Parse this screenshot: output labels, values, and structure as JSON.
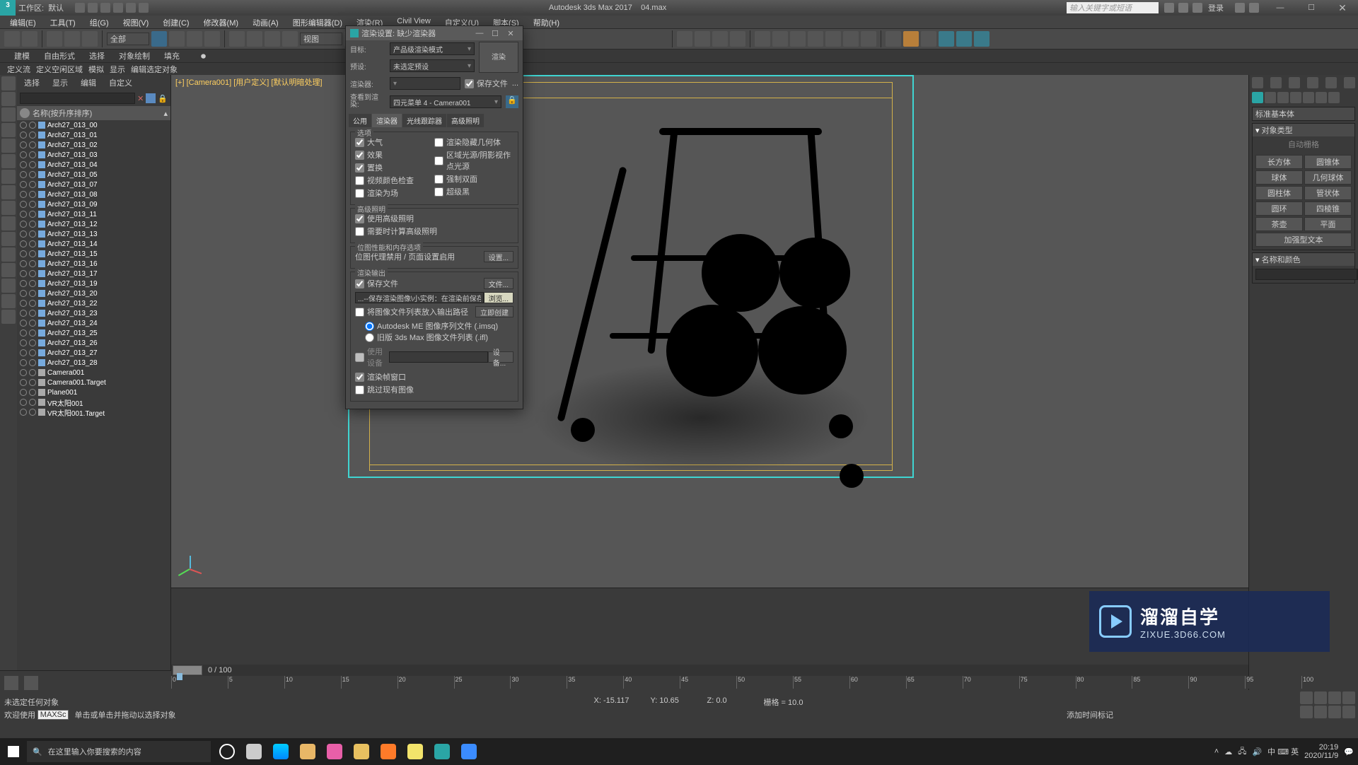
{
  "title_app": "Autodesk 3ds Max 2017",
  "title_file": "04.max",
  "workspace_label": "工作区:",
  "workspace_name": "默认",
  "search_placeholder": "输入关键字或短语",
  "signin": "登录",
  "menus": [
    "编辑(E)",
    "工具(T)",
    "组(G)",
    "视图(V)",
    "创建(C)",
    "修改器(M)",
    "动画(A)",
    "图形编辑器(D)",
    "渲染(R)",
    "Civil View",
    "自定义(U)",
    "脚本(S)",
    "帮助(H)"
  ],
  "ribbon_dropdown": "全部",
  "ribbon_view": "视图",
  "subbar1": [
    "建模",
    "自由形式",
    "选择",
    "对象绘制",
    "填充"
  ],
  "subbar2": [
    "定义流",
    "定义空闲区域",
    "模拟",
    "显示",
    "编辑选定对象"
  ],
  "scene_modes": [
    "选择",
    "显示",
    "编辑",
    "自定义"
  ],
  "scene_header": "名称(按升序排序)",
  "scene_items": [
    "Arch27_013_00",
    "Arch27_013_01",
    "Arch27_013_02",
    "Arch27_013_03",
    "Arch27_013_04",
    "Arch27_013_05",
    "Arch27_013_07",
    "Arch27_013_08",
    "Arch27_013_09",
    "Arch27_013_11",
    "Arch27_013_12",
    "Arch27_013_13",
    "Arch27_013_14",
    "Arch27_013_15",
    "Arch27_013_16",
    "Arch27_013_17",
    "Arch27_013_19",
    "Arch27_013_20",
    "Arch27_013_22",
    "Arch27_013_23",
    "Arch27_013_24",
    "Arch27_013_25",
    "Arch27_013_26",
    "Arch27_013_27",
    "Arch27_013_28",
    "Camera001",
    "Camera001.Target",
    "Plane001",
    "VR太阳001",
    "VR太阳001.Target"
  ],
  "viewport_label": "[+] [Camera001] [用户定义] [默认明暗处理]",
  "material_btn": {
    "label": "工作区:",
    "name": "默认"
  },
  "timeline": {
    "range": "0 / 100",
    "ticks": [
      "0",
      "5",
      "10",
      "15",
      "20",
      "25",
      "30",
      "35",
      "40",
      "45",
      "50",
      "55",
      "60",
      "65",
      "70",
      "75",
      "80",
      "85",
      "90",
      "95",
      "100"
    ]
  },
  "status": {
    "noselect": "未选定任何对象",
    "hint": "单击或单击并拖动以选择对象",
    "x": "X: -15.117",
    "y": "Y: 10.65",
    "z": "Z: 0.0",
    "grid": "栅格 = 10.0",
    "addtime": "添加时间标记"
  },
  "welcome": "欢迎使用",
  "maxs": "MAXSc",
  "rightpanel": {
    "dropdown": "标准基本体",
    "sect1": "对象类型",
    "autogrid": "自动栅格",
    "prims": [
      "长方体",
      "圆锥体",
      "球体",
      "几何球体",
      "圆柱体",
      "管状体",
      "圆环",
      "四棱锥",
      "茶壶",
      "平面",
      "加强型文本"
    ],
    "sect2": "名称和颜色"
  },
  "dialog": {
    "title": "渲染设置: 缺少渲染器",
    "target_l": "目标:",
    "target_v": "产品级渲染模式",
    "preset_l": "预设:",
    "preset_v": "未选定预设",
    "renderer_l": "渲染器:",
    "renderer_v": "",
    "savefile": "保存文件",
    "render_btn": "渲染",
    "viewto_l": "查看到渲染:",
    "viewto_v": "四元菜单 4 - Camera001",
    "tabs": [
      "公用",
      "渲染器",
      "光线跟踪器",
      "高级照明"
    ],
    "grp_opts": "选项",
    "opts_l": [
      "大气",
      "效果",
      "置换",
      "视频颜色检查",
      "渲染为场"
    ],
    "opts_r": [
      "渲染隐藏几何体",
      "区域光源/阴影视作点光源",
      "强制双面",
      "超级黑"
    ],
    "grp_adv": "高级照明",
    "adv": [
      "使用高级照明",
      "需要时计算高级照明"
    ],
    "grp_mem": "位图性能和内存选项",
    "mem_line": "位图代理禁用 / 页面设置启用",
    "mem_btn": "设置...",
    "grp_out": "渲染输出",
    "out_save": "保存文件",
    "out_file_btn": "文件...",
    "out_path": "...--保存渲染图像\\小实例：在渲染前保存要渲染的",
    "out_browse": "浏览...",
    "out_putlist": "将图像文件列表放入输出路径",
    "out_create": "立即创建",
    "out_r1": "Autodesk ME 图像序列文件 (.imsq)",
    "out_r2": "旧版 3ds Max 图像文件列表 (.ifl)",
    "out_usedev": "使用设备",
    "out_dev_btn": "设备...",
    "out_window": "渲染帧窗口",
    "out_skip": "跳过现有图像"
  },
  "watermark": {
    "cn": "溜溜自学",
    "en": "ZIXUE.3D66.COM"
  },
  "taskbar": {
    "search": "在这里输入你要搜索的内容",
    "ime": "中 ⌨ 英",
    "time": "20:19",
    "date": "2020/11/9"
  }
}
